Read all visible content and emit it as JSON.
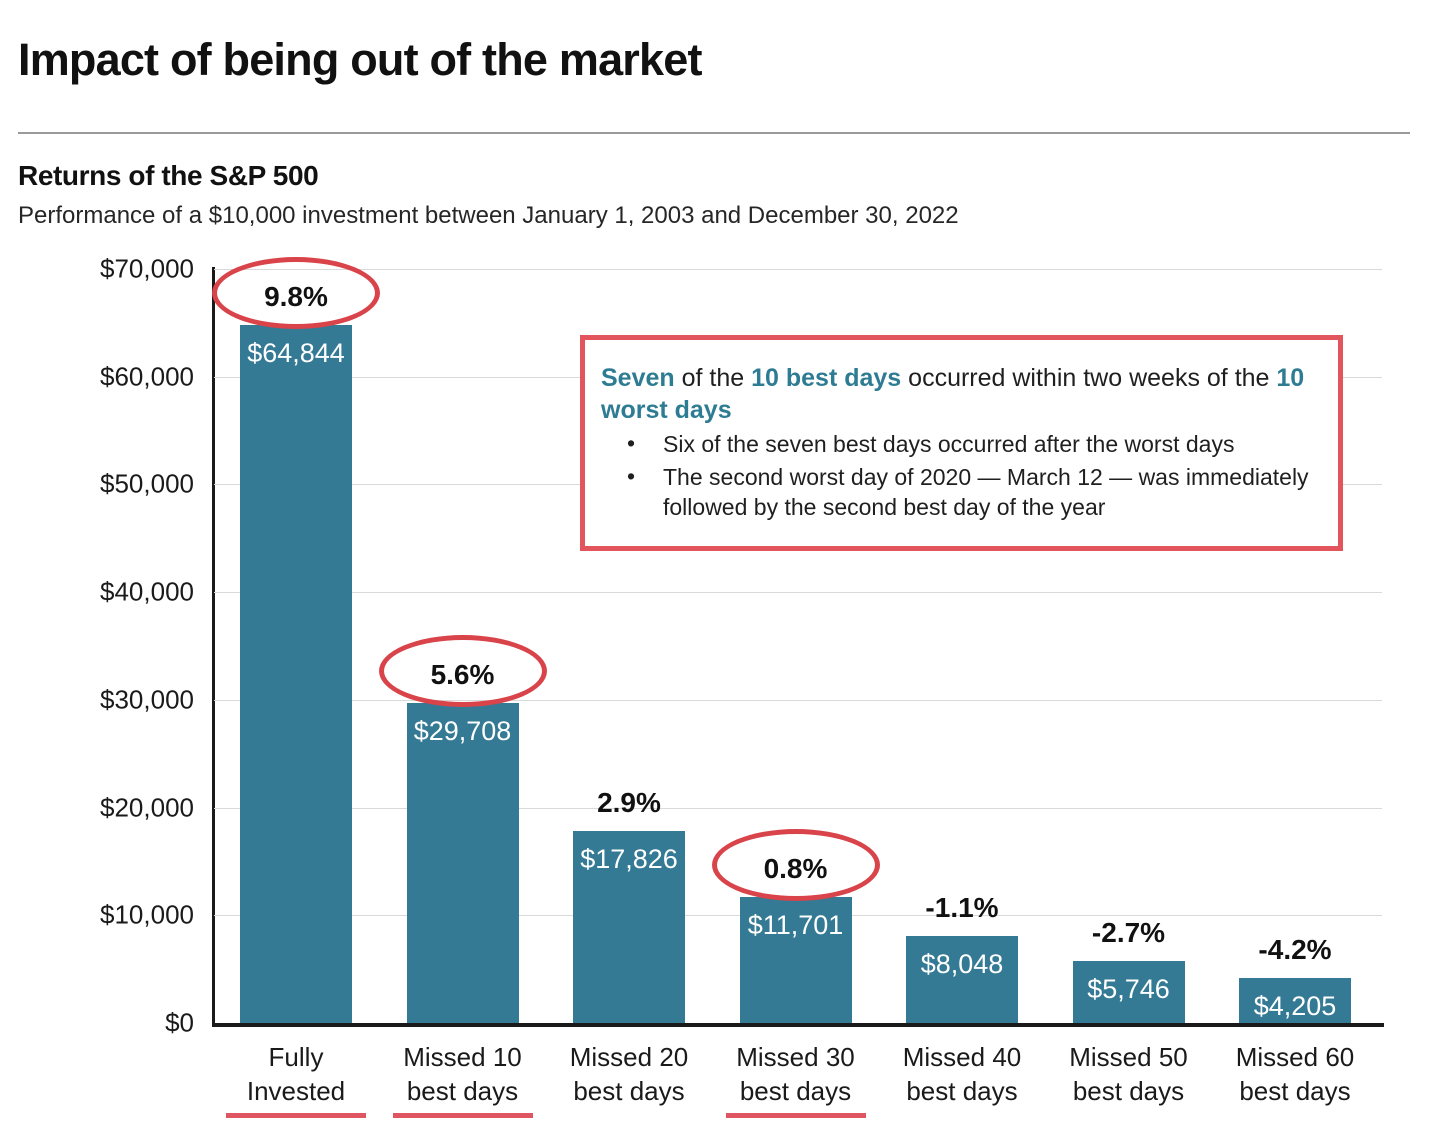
{
  "header": {
    "main_title": "Impact of being out of the market",
    "chart_title": "Returns of the S&P 500",
    "chart_subtitle": "Performance of a $10,000 investment between January 1, 2003 and December 30, 2022"
  },
  "callout": {
    "lead_part_1": "Seven",
    "lead_part_2": " of the ",
    "lead_part_3": "10 best days",
    "lead_part_4": " occurred within two weeks of the ",
    "lead_part_5": "10 worst days",
    "bullets": [
      "Six of the seven best days occurred after the worst days",
      "The second worst day of 2020 — March 12 — was immediately followed by the second best day of the year"
    ]
  },
  "colors": {
    "bar": "#357a94",
    "annotation_red": "#d9434a",
    "underline_red": "#e05562",
    "callout_border": "#e2555c",
    "highlight_teal": "#2e7c93",
    "gridline": "#d9d9d9",
    "axis": "#1a1a1a"
  },
  "chart_data": {
    "type": "bar",
    "title": "Returns of the S&P 500",
    "subtitle": "Performance of a $10,000 investment between January 1, 2003 and December 30, 2022",
    "xlabel": "",
    "ylabel": "",
    "ylim": [
      0,
      70000
    ],
    "ytick_values": [
      0,
      10000,
      20000,
      30000,
      40000,
      50000,
      60000,
      70000
    ],
    "ytick_labels": [
      "$0",
      "$10,000",
      "$20,000",
      "$30,000",
      "$40,000",
      "$50,000",
      "$60,000",
      "$70,000"
    ],
    "grid": true,
    "legend": "none",
    "categories": [
      "Fully Invested",
      "Missed 10 best days",
      "Missed 20 best days",
      "Missed 30 best days",
      "Missed 40 best days",
      "Missed 50 best days",
      "Missed 60 best days"
    ],
    "category_lines": [
      [
        "Fully",
        "Invested"
      ],
      [
        "Missed 10",
        "best days"
      ],
      [
        "Missed 20",
        "best days"
      ],
      [
        "Missed 30",
        "best days"
      ],
      [
        "Missed 40",
        "best days"
      ],
      [
        "Missed 50",
        "best days"
      ],
      [
        "Missed 60",
        "best days"
      ]
    ],
    "values": [
      64844,
      29708,
      17826,
      11701,
      8048,
      5746,
      4205
    ],
    "value_labels": [
      "$64,844",
      "$29,708",
      "$17,826",
      "$11,701",
      "$8,048",
      "$5,746",
      "$4,205"
    ],
    "annualized_return_pct": [
      9.8,
      5.6,
      2.9,
      0.8,
      -1.1,
      -2.7,
      -4.2
    ],
    "annualized_return_labels": [
      "9.8%",
      "5.6%",
      "2.9%",
      "0.8%",
      "-1.1%",
      "-2.7%",
      "-4.2%"
    ],
    "circled_indices": [
      0,
      1,
      3
    ],
    "underlined_indices": [
      0,
      1,
      3
    ]
  }
}
